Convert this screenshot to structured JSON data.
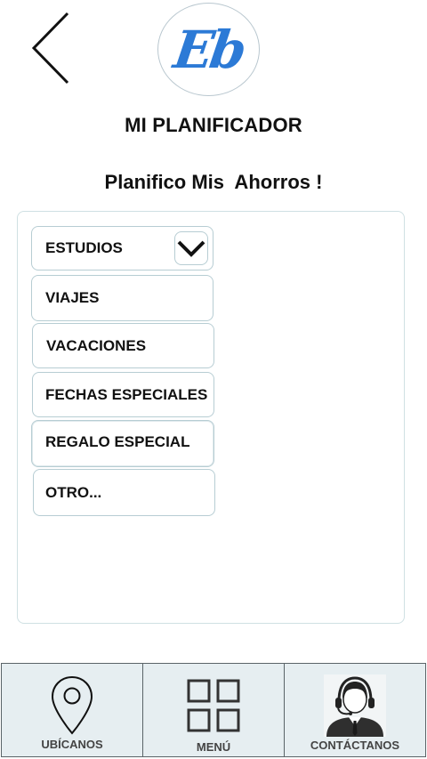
{
  "header": {
    "logo_text": "Eb",
    "title": "MI PLANIFICADOR",
    "subtitle": "Planifico Mis  Ahorros !"
  },
  "options": [
    {
      "label": "ESTUDIOS",
      "icon": "chevron-down-icon"
    },
    {
      "label": "VIAJES"
    },
    {
      "label": "VACACIONES"
    },
    {
      "label": "FECHAS ESPECIALES"
    },
    {
      "label": "REGALO ESPECIAL"
    },
    {
      "label": "OTRO..."
    }
  ],
  "bottom_nav": {
    "items": [
      {
        "label": "UBÍCANOS",
        "icon": "location-pin-icon"
      },
      {
        "label": "MENÚ",
        "icon": "grid-icon"
      },
      {
        "label": "CONTÁCTANOS",
        "icon": "support-agent-icon"
      }
    ]
  },
  "colors": {
    "brand": "#2c7ad6",
    "border": "#b7cdd3",
    "nav_background": "#e6eef1"
  }
}
